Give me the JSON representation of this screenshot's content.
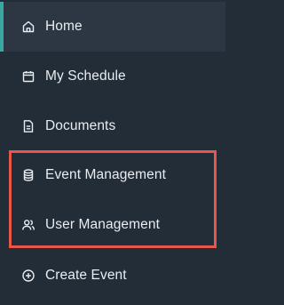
{
  "sidebar": {
    "items": [
      {
        "label": "Home",
        "icon": "home-icon",
        "active": true
      },
      {
        "label": "My Schedule",
        "icon": "calendar-icon",
        "active": false
      },
      {
        "label": "Documents",
        "icon": "document-icon",
        "active": false
      },
      {
        "label": "Event Management",
        "icon": "database-icon",
        "active": false
      },
      {
        "label": "User Management",
        "icon": "users-icon",
        "active": false
      },
      {
        "label": "Create Event",
        "icon": "plus-circle-icon",
        "active": false
      }
    ]
  },
  "colors": {
    "background": "#232d38",
    "active_background": "#2c3743",
    "active_accent": "#3aa8a0",
    "text": "#e9edf1",
    "highlight": "#e8574a"
  }
}
